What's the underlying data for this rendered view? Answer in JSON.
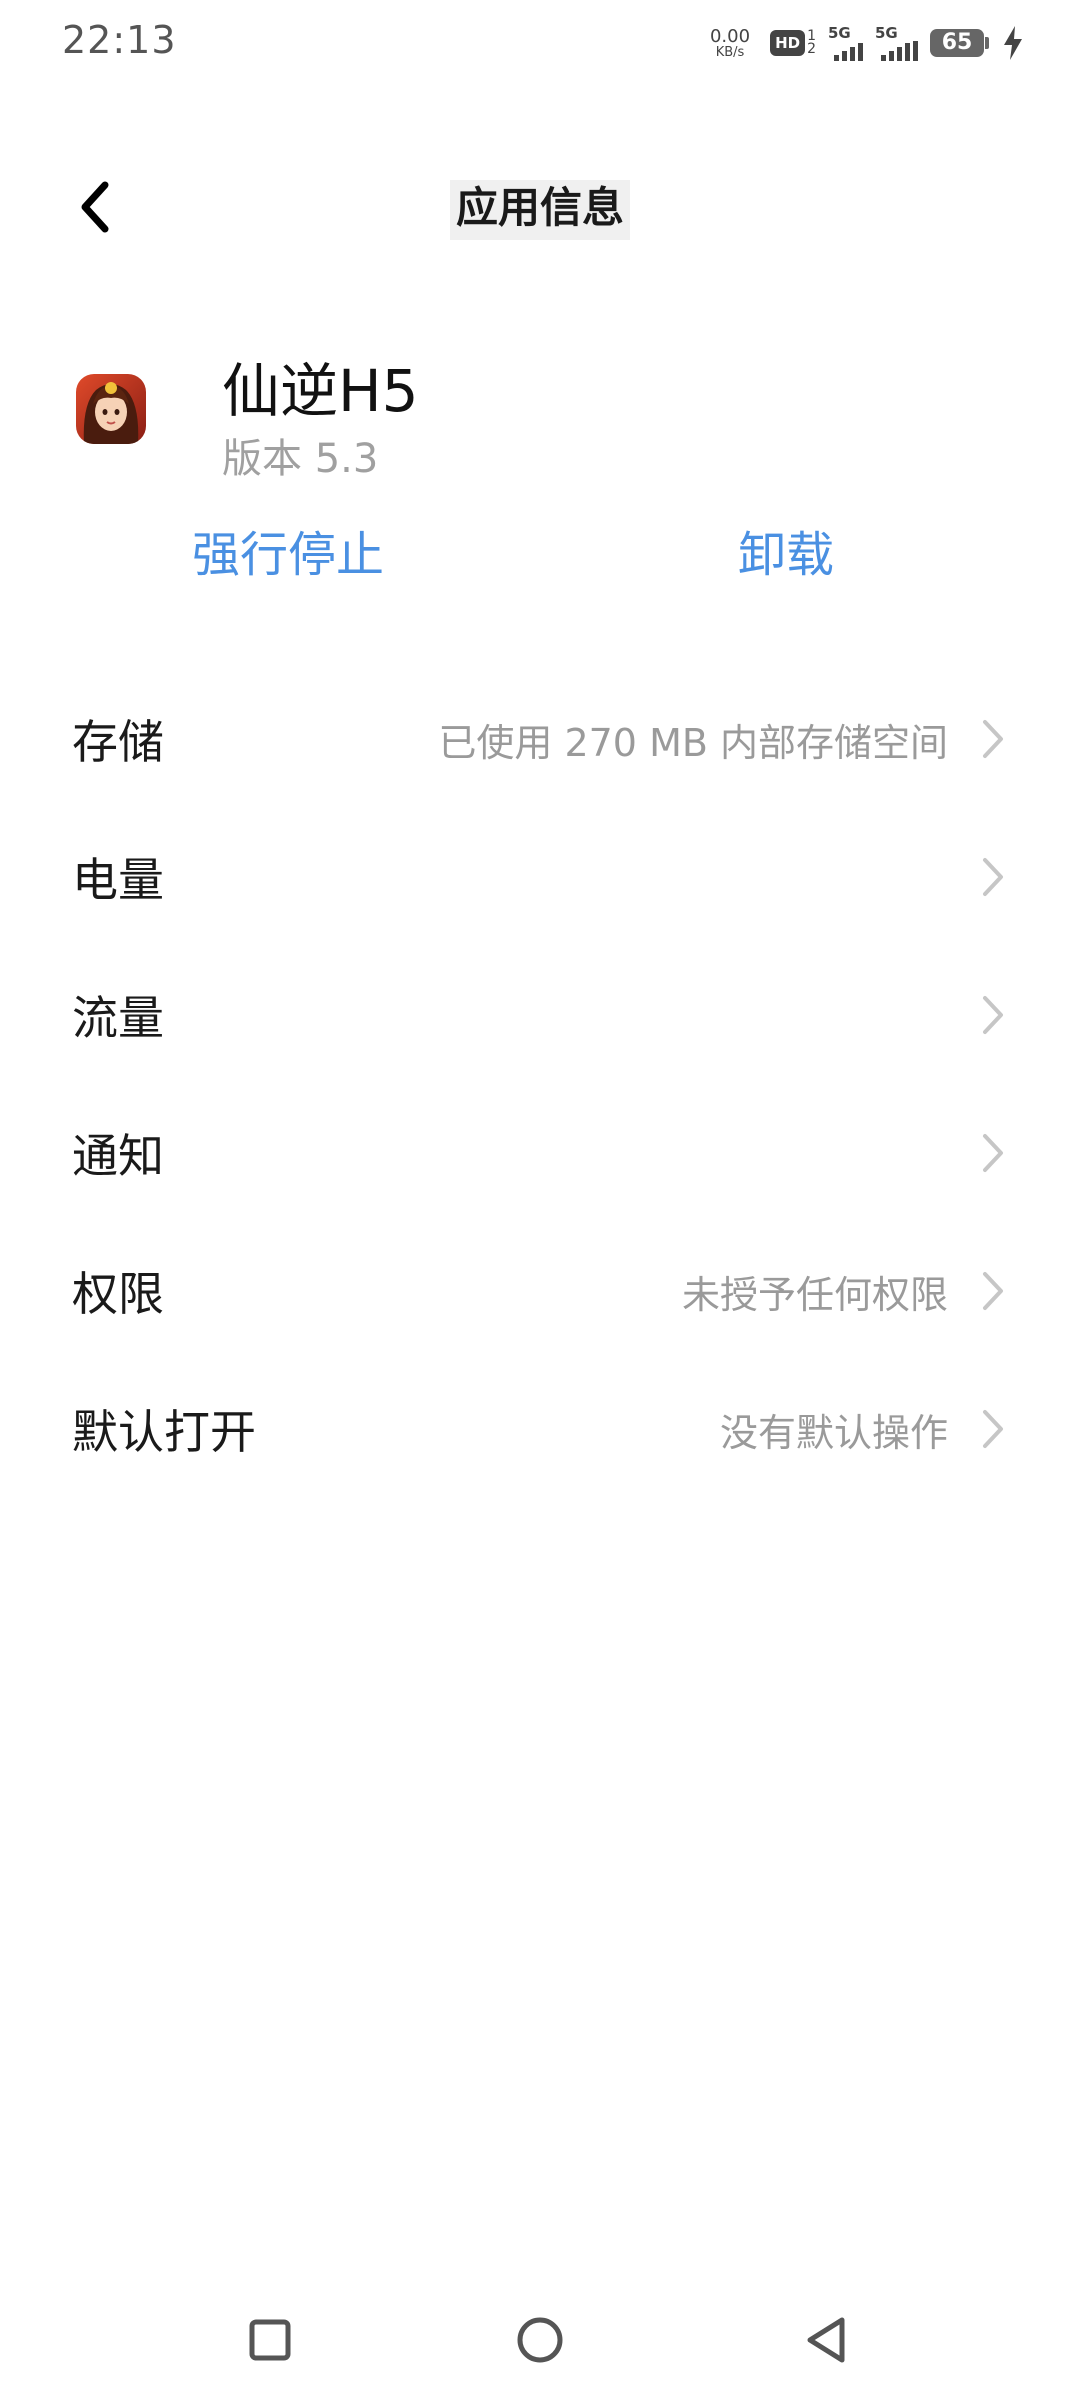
{
  "status_bar": {
    "time": "22:13",
    "net_speed_value": "0.00",
    "net_speed_unit": "KB/s",
    "hd_label": "HD",
    "hd_sub_top": "1",
    "hd_sub_bottom": "2",
    "sim1_tag": "5G",
    "sim2_tag": "5G",
    "battery_level": "65",
    "icons": [
      "hd-volte-icon",
      "signal-5g-icon",
      "signal-5g-icon",
      "battery-icon",
      "charging-bolt-icon"
    ]
  },
  "header": {
    "back_icon": "back-arrow-icon",
    "title": "应用信息"
  },
  "app": {
    "name": "仙逆H5",
    "version": "版本 5.3",
    "icon": "app-icon"
  },
  "actions": {
    "force_stop": "强行停止",
    "uninstall": "卸载",
    "accent_color": "#4a90e2"
  },
  "settings": [
    {
      "label": "存储",
      "value": "已使用 270 MB 内部存储空间"
    },
    {
      "label": "电量",
      "value": ""
    },
    {
      "label": "流量",
      "value": ""
    },
    {
      "label": "通知",
      "value": ""
    },
    {
      "label": "权限",
      "value": "未授予任何权限"
    },
    {
      "label": "默认打开",
      "value": "没有默认操作"
    }
  ],
  "nav_bar": {
    "icons": [
      "recents-square-icon",
      "home-circle-icon",
      "back-triangle-icon"
    ]
  }
}
